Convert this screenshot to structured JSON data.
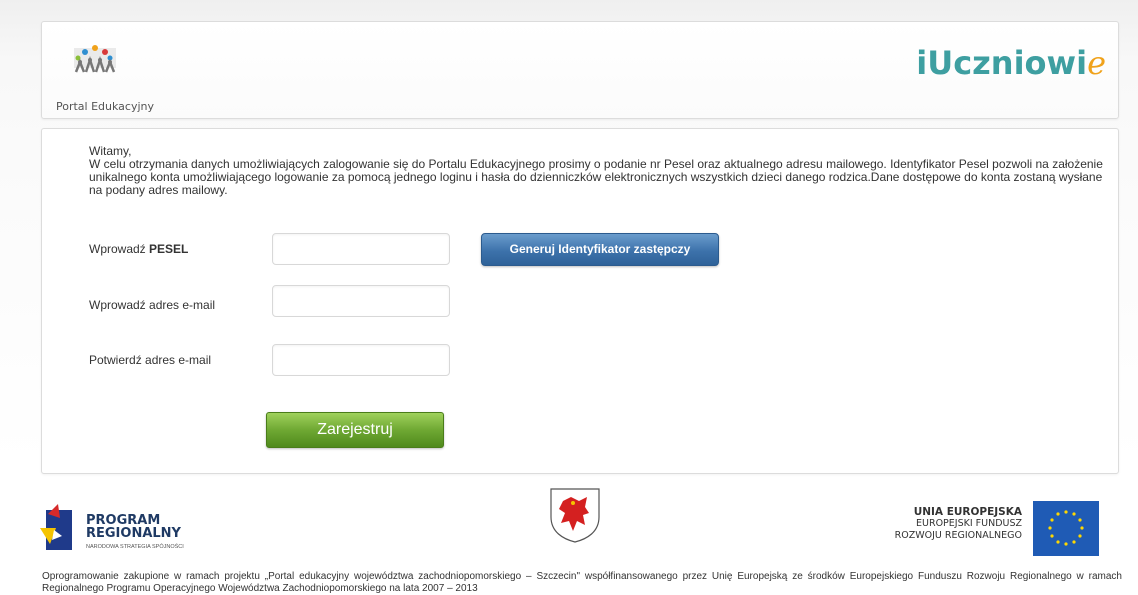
{
  "header": {
    "portal_logo_text": "Portal Edukacyjny",
    "brand_main": "iUczniowi",
    "brand_tail": "e"
  },
  "intro": {
    "greeting": "Witamy,",
    "body": "W celu otrzymania danych umożliwiających zalogowanie się do Portalu Edukacyjnego prosimy o podanie nr Pesel oraz aktualnego adresu mailowego. Identyfikator Pesel pozwoli na założenie unikalnego konta umożliwiającego logowanie za pomocą jednego loginu i hasła do dzienniczków elektronicznych wszystkich dzieci danego rodzica.Dane dostępowe do konta zostaną wysłane na podany adres mailowy."
  },
  "form": {
    "pesel_label_prefix": "Wprowadź ",
    "pesel_label_bold": "PESEL",
    "pesel_value": "",
    "email_label": "Wprowadź adres e-mail",
    "email_value": "",
    "email_confirm_label": "Potwierdź adres e-mail",
    "email_confirm_value": "",
    "generate_button": "Generuj Identyfikator zastępczy",
    "submit_button": "Zarejestruj"
  },
  "footer": {
    "program_line1": "PROGRAM",
    "program_line2": "REGIONALNY",
    "program_sub": "NARODOWA STRATEGIA SPÓJNOŚCI",
    "eu_title": "UNIA EUROPEJSKA",
    "eu_line2": "EUROPEJSKI FUNDUSZ",
    "eu_line3": "ROZWOJU REGIONALNEGO",
    "note": "Oprogramowanie zakupione w ramach projektu „Portal edukacyjny województwa zachodniopomorskiego – Szczecin\" współfinansowanego przez Unię Europejską ze środków Europejskiego Funduszu Rozwoju Regionalnego w ramach Regionalnego Programu Operacyjnego Województwa Zachodniopomorskiego na lata 2007 – 2013"
  },
  "colors": {
    "brand_teal": "#3e9fa1",
    "brand_orange": "#f0a21b",
    "button_blue": "#3d72ab",
    "button_green": "#6fa833"
  }
}
